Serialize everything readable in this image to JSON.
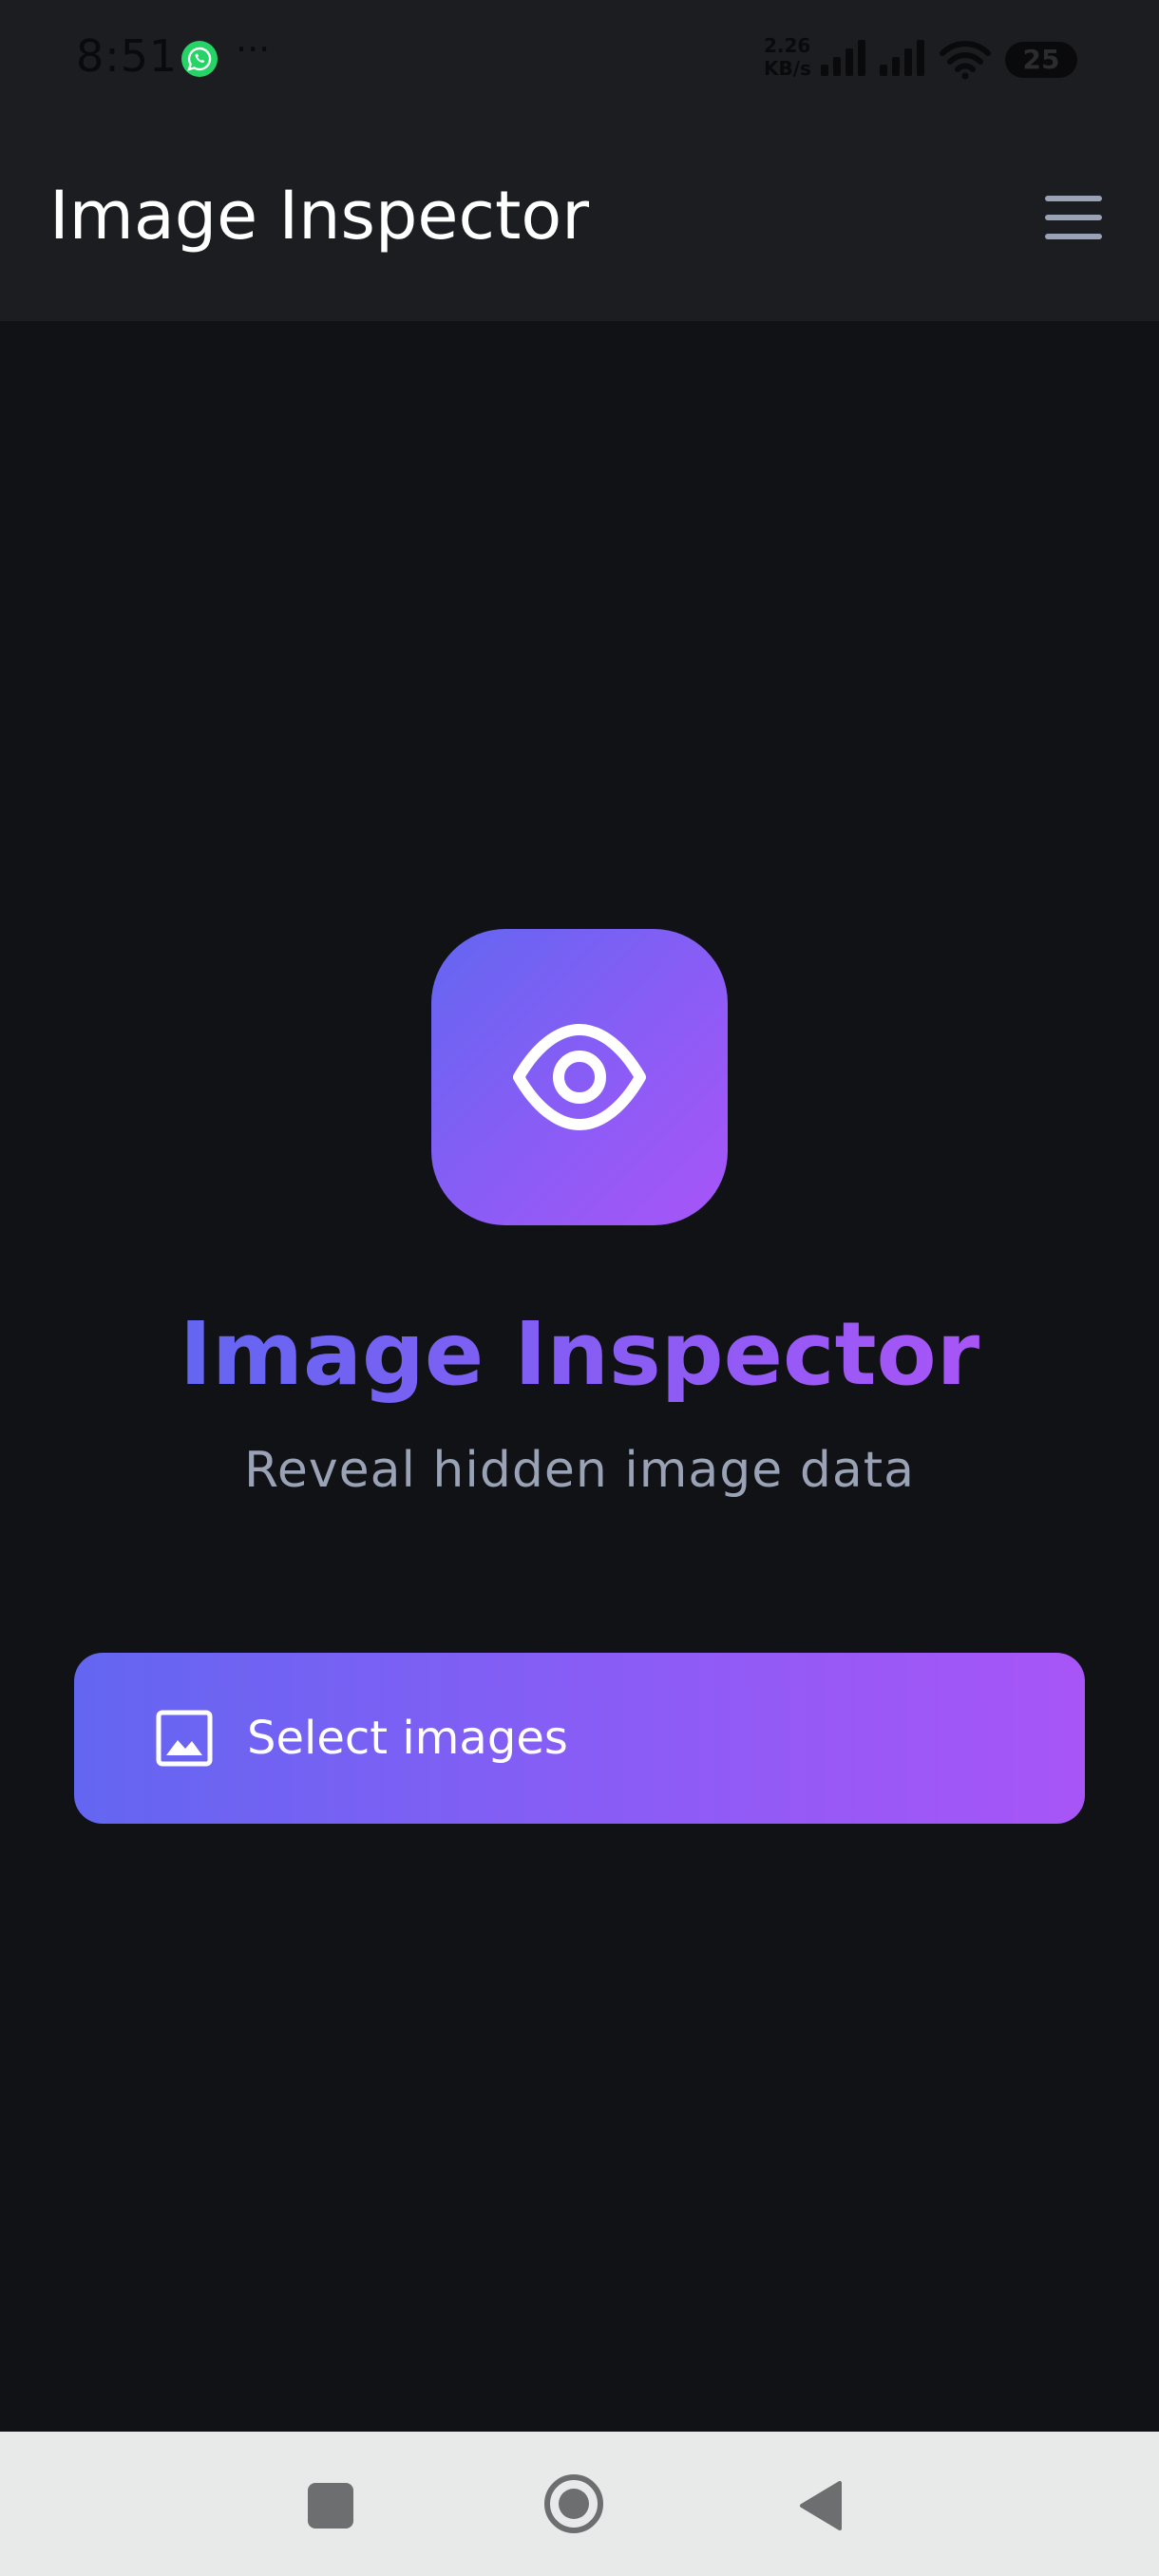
{
  "status_bar": {
    "time": "8:51",
    "more_indicator": "···",
    "net_speed_value": "2.26",
    "net_speed_unit": "KB/s",
    "battery_level": "25",
    "icons": [
      "whatsapp-icon",
      "signal-icon",
      "signal-icon",
      "wifi-icon",
      "battery-icon"
    ]
  },
  "app_bar": {
    "title": "Image Inspector",
    "menu_icon": "hamburger-menu-icon"
  },
  "hero": {
    "logo_icon": "eye-icon",
    "title": "Image Inspector",
    "subtitle": "Reveal hidden image data"
  },
  "actions": {
    "select_images_label": "Select images",
    "select_images_icon": "image-icon"
  },
  "nav_bar": {
    "icons": [
      "recent-apps-icon",
      "home-icon",
      "back-icon"
    ]
  },
  "colors": {
    "background": "#111216",
    "app_bar": "#1b1d21",
    "gradient_start": "#6366f1",
    "gradient_end": "#a855f7",
    "subtitle": "#9aa3b5",
    "nav_bar": "#e8e9e9"
  }
}
